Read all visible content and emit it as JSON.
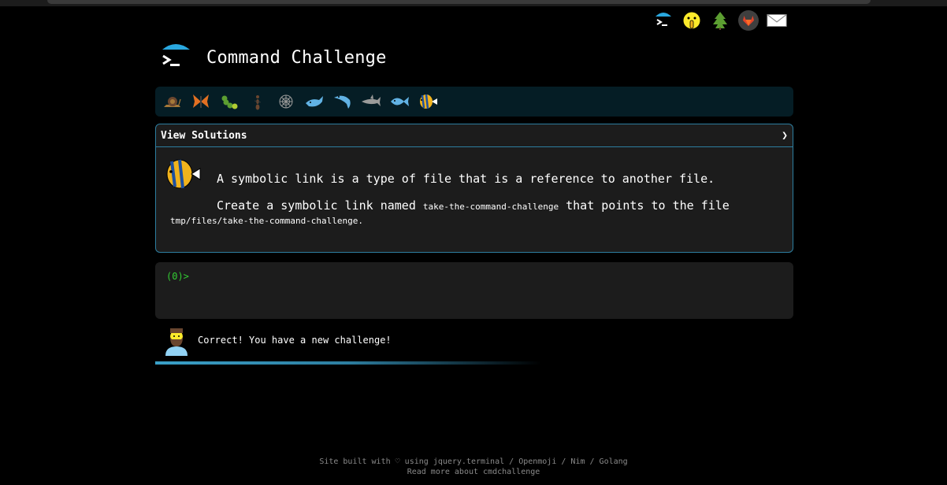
{
  "app": {
    "title": "Command Challenge"
  },
  "top_icons": [
    {
      "name": "terminal-logo-icon"
    },
    {
      "name": "shushing-face-icon"
    },
    {
      "name": "tree-icon"
    },
    {
      "name": "gitlab-icon"
    },
    {
      "name": "mail-icon"
    }
  ],
  "levels": [
    {
      "name": "snail-icon"
    },
    {
      "name": "butterfly-icon"
    },
    {
      "name": "caterpillar-icon"
    },
    {
      "name": "ant-icon"
    },
    {
      "name": "web-icon"
    },
    {
      "name": "whale-icon"
    },
    {
      "name": "dolphin-icon"
    },
    {
      "name": "shark-icon"
    },
    {
      "name": "fish-icon"
    },
    {
      "name": "tropical-fish-icon"
    }
  ],
  "solutions": {
    "label": "View Solutions",
    "chevron": "❯"
  },
  "challenge": {
    "line1": "A symbolic link is a type of file that is a reference to another file.",
    "line2_a": "Create a symbolic link named ",
    "line2_code": "take-the-command-challenge",
    "line2_b": " that points to the file",
    "line3_code": "tmp/files/take-the-command-challenge",
    "line3_end": "."
  },
  "terminal": {
    "prompt": "(0)>"
  },
  "feedback": {
    "text": "Correct! You have a new challenge!"
  },
  "progress": {
    "fraction": 0.6
  },
  "footer": {
    "line1_prefix": "Site built with ♡ using ",
    "link_jquery": "jquery.terminal",
    "sep1": " / ",
    "link_openmoji": "Openmoji",
    "sep2": " / ",
    "link_nim": "Nim",
    "sep3": " / ",
    "link_golang": "Golang",
    "line2": "Read more about cmdchallenge"
  },
  "colors": {
    "accent": "#2d7ea0",
    "prompt": "#33cc33",
    "level_bar_bg": "#051d25"
  }
}
